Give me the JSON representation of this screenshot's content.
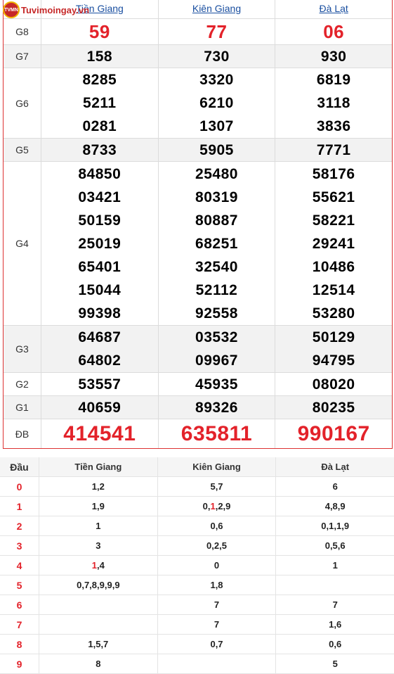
{
  "site": {
    "logo_text": "Tuvimoingay.vn",
    "badge": "TVMN"
  },
  "provinces": [
    "Tiền Giang",
    "Kiên Giang",
    "Đà Lạt"
  ],
  "prizes": [
    {
      "label": "G8",
      "values": [
        [
          "59"
        ],
        [
          "77"
        ],
        [
          "06"
        ]
      ]
    },
    {
      "label": "G7",
      "values": [
        [
          "158"
        ],
        [
          "730"
        ],
        [
          "930"
        ]
      ]
    },
    {
      "label": "G6",
      "values": [
        [
          "8285",
          "5211",
          "0281"
        ],
        [
          "3320",
          "6210",
          "1307"
        ],
        [
          "6819",
          "3118",
          "3836"
        ]
      ]
    },
    {
      "label": "G5",
      "values": [
        [
          "8733"
        ],
        [
          "5905"
        ],
        [
          "7771"
        ]
      ]
    },
    {
      "label": "G4",
      "values": [
        [
          "84850",
          "03421",
          "50159",
          "25019",
          "65401",
          "15044",
          "99398"
        ],
        [
          "25480",
          "80319",
          "80887",
          "68251",
          "32540",
          "52112",
          "92558"
        ],
        [
          "58176",
          "55621",
          "58221",
          "29241",
          "10486",
          "12514",
          "53280"
        ]
      ]
    },
    {
      "label": "G3",
      "values": [
        [
          "64687",
          "64802"
        ],
        [
          "03532",
          "09967"
        ],
        [
          "50129",
          "94795"
        ]
      ]
    },
    {
      "label": "G2",
      "values": [
        [
          "53557"
        ],
        [
          "45935"
        ],
        [
          "08020"
        ]
      ]
    },
    {
      "label": "G1",
      "values": [
        [
          "40659"
        ],
        [
          "89326"
        ],
        [
          "80235"
        ]
      ]
    },
    {
      "label": "ĐB",
      "values": [
        [
          "414541"
        ],
        [
          "635811"
        ],
        [
          "990167"
        ]
      ]
    }
  ],
  "loto": {
    "header": {
      "dau": "Đầu",
      "cols": [
        "Tiền Giang",
        "Kiên Giang",
        "Đà Lạt"
      ]
    },
    "rows": [
      {
        "dau": "0",
        "cells": [
          "1,2",
          "5,7",
          "6"
        ]
      },
      {
        "dau": "1",
        "cells": [
          "1,9",
          "0,1,2,9",
          "4,8,9"
        ]
      },
      {
        "dau": "2",
        "cells": [
          "1",
          "0,6",
          "0,1,1,9"
        ]
      },
      {
        "dau": "3",
        "cells": [
          "3",
          "0,2,5",
          "0,5,6"
        ]
      },
      {
        "dau": "4",
        "cells": [
          "1,4",
          "0",
          "1"
        ]
      },
      {
        "dau": "5",
        "cells": [
          "0,7,8,9,9,9",
          "1,8",
          ""
        ]
      },
      {
        "dau": "6",
        "cells": [
          "",
          "7",
          "7"
        ]
      },
      {
        "dau": "7",
        "cells": [
          "",
          "7",
          "1,6"
        ]
      },
      {
        "dau": "8",
        "cells": [
          "1,5,7",
          "0,7",
          "0,6"
        ]
      },
      {
        "dau": "9",
        "cells": [
          "8",
          "",
          "5"
        ]
      }
    ],
    "highlights": {
      "row1_col1_digit": "1",
      "row4_col0_digit": "1",
      "row6_col2": "7"
    }
  }
}
